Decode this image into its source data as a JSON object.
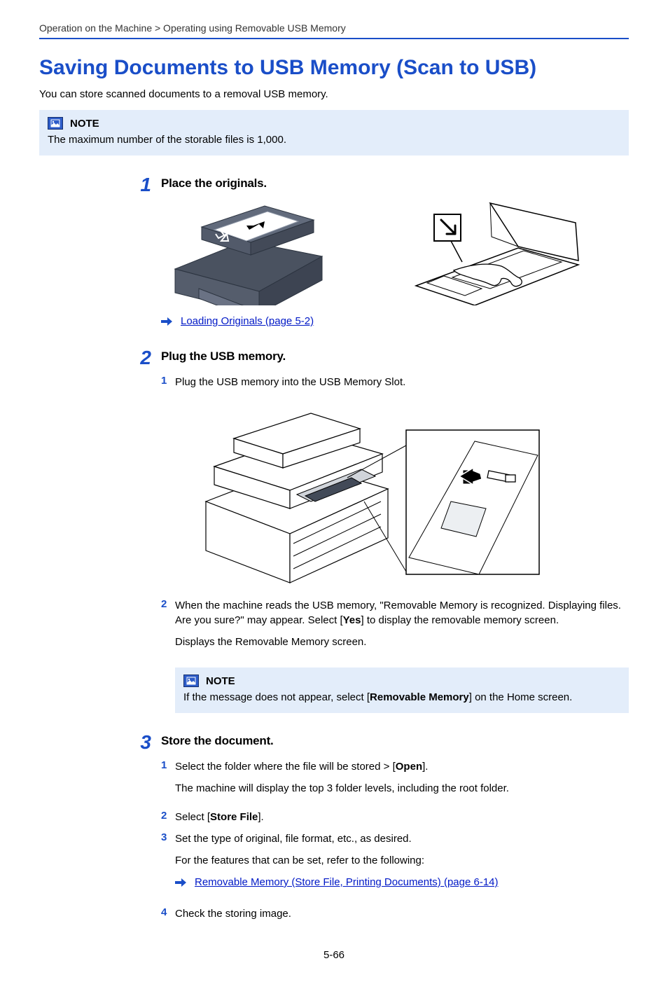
{
  "breadcrumb": "Operation on the Machine > Operating using Removable USB Memory",
  "page_title": "Saving Documents to USB Memory (Scan to USB)",
  "intro": "You can store scanned documents to a removal USB memory.",
  "note_label": "NOTE",
  "note_body": "The maximum number of the storable files is 1,000.",
  "steps": {
    "s1": {
      "num": "1",
      "title": "Place the originals.",
      "ref": "Loading Originals (page 5-2)"
    },
    "s2": {
      "num": "2",
      "title": "Plug the USB memory.",
      "sub1": {
        "num": "1",
        "text": "Plug the USB memory into the USB Memory Slot."
      },
      "sub2": {
        "num": "2",
        "text_a": "When the machine reads the USB memory, \"Removable Memory is recognized. Displaying files. Are you sure?\" may appear. Select [",
        "text_b": "Yes",
        "text_c": "] to display the removable memory screen.",
        "extra": "Displays the Removable Memory screen."
      },
      "note": {
        "text_a": "If the message does not appear, select [",
        "text_b": "Removable Memory",
        "text_c": "] on the Home screen."
      }
    },
    "s3": {
      "num": "3",
      "title": "Store the document.",
      "sub1": {
        "num": "1",
        "text_a": "Select the folder where the file will be stored > [",
        "text_b": "Open",
        "text_c": "].",
        "extra": "The machine will display the top 3 folder levels, including the root folder."
      },
      "sub2": {
        "num": "2",
        "text_a": "Select [",
        "text_b": "Store File",
        "text_c": "]."
      },
      "sub3": {
        "num": "3",
        "text": "Set the type of original, file format, etc., as desired.",
        "extra": "For the features that can be set, refer to the following:",
        "ref": "Removable Memory (Store File, Printing Documents) (page 6-14)"
      },
      "sub4": {
        "num": "4",
        "text": "Check the storing image."
      }
    }
  },
  "page_num": "5-66"
}
